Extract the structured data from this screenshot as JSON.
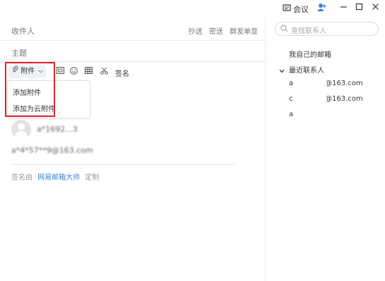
{
  "topbar": {
    "meeting_label": "会议",
    "icons": [
      "meeting-icon",
      "add-contact-icon",
      "minimize-icon",
      "maximize-icon",
      "close-icon"
    ]
  },
  "compose": {
    "recipient_label": "收件人",
    "cc_label": "抄送",
    "bcc_label": "密送",
    "group_send_label": "群发单显",
    "subject_label": "主题",
    "toolbar": {
      "attach_label": "附件",
      "signature_label": "签名",
      "icons": [
        "paperclip-icon",
        "chevron-down-icon",
        "screenshot-icon",
        "emoji-icon",
        "table-icon",
        "scissors-icon"
      ]
    },
    "attach_menu": {
      "items": [
        "添加附件",
        "添加为云附件"
      ]
    },
    "sender_name": "a*1692...3",
    "sender_email": "a*4*57**9@163.com",
    "signature_line": {
      "prefix": "签名由",
      "link": "网易邮箱大师",
      "suffix": "定制"
    }
  },
  "right_panel": {
    "search_placeholder": "查找联系人",
    "my_mailbox": "我自己的邮箱",
    "recent_contacts": "最近联系人",
    "contacts": [
      "a",
      "@163.com",
      "c",
      "@163.com",
      "a"
    ]
  },
  "colors": {
    "highlight_border": "#e0232b",
    "link": "#3a86d4",
    "toolbar_button_bg": "#eef2f8"
  }
}
